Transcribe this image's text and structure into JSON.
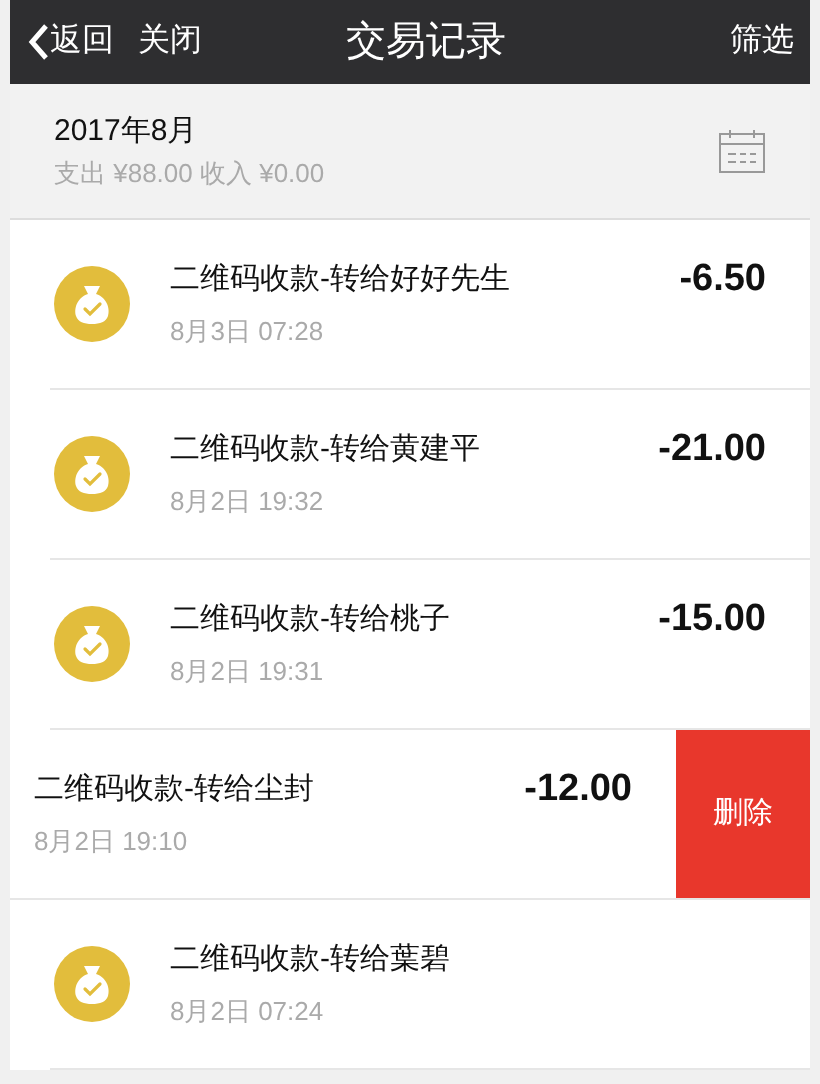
{
  "nav": {
    "back": "返回",
    "close": "关闭",
    "title": "交易记录",
    "filter": "筛选"
  },
  "summary": {
    "month": "2017年8月",
    "totals": "支出 ¥88.00 收入 ¥0.00"
  },
  "rows": [
    {
      "name": "二维码收款-转给好好先生",
      "time": "8月3日 07:28",
      "amount": "-6.50",
      "swiped": false
    },
    {
      "name": "二维码收款-转给黄建平",
      "time": "8月2日 19:32",
      "amount": "-21.00",
      "swiped": false
    },
    {
      "name": "二维码收款-转给桃子",
      "time": "8月2日 19:31",
      "amount": "-15.00",
      "swiped": false
    },
    {
      "name": "二维码收款-转给尘封",
      "time": "8月2日 19:10",
      "amount": "-12.00",
      "swiped": true,
      "delete_label": "删除"
    },
    {
      "name": "二维码收款-转给葉碧",
      "time": "8月2日 07:24",
      "swiped": false
    }
  ]
}
